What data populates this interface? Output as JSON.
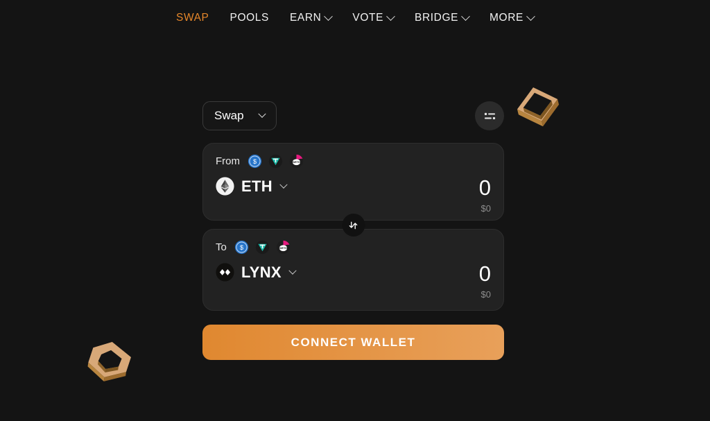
{
  "theme": {
    "page_bg": "#141414",
    "card_bg": "#222222",
    "accent": "#e5862a",
    "button_gradient_from": "#e08830",
    "button_gradient_to": "#e8a05a",
    "text_primary": "#ffffff",
    "text_muted": "#8d8d8d"
  },
  "nav": {
    "items": [
      {
        "label": "SWAP",
        "active": true,
        "has_caret": false
      },
      {
        "label": "POOLS",
        "active": false,
        "has_caret": false
      },
      {
        "label": "EARN",
        "active": false,
        "has_caret": true
      },
      {
        "label": "VOTE",
        "active": false,
        "has_caret": true
      },
      {
        "label": "BRIDGE",
        "active": false,
        "has_caret": true
      },
      {
        "label": "MORE",
        "active": false,
        "has_caret": true
      }
    ]
  },
  "widget": {
    "mode_label": "Swap",
    "settings_icon": "sliders-icon",
    "flip_icon": "swap-vertical-icon",
    "connect_label": "CONNECT WALLET",
    "from": {
      "label": "From",
      "quick_tokens": [
        "USDC",
        "USDT",
        "WETH"
      ],
      "token_symbol": "ETH",
      "token_icon": "eth-icon",
      "amount": "0",
      "amount_placeholder": "0",
      "usd_value": "$0"
    },
    "to": {
      "label": "To",
      "quick_tokens": [
        "USDC",
        "USDT",
        "WETH"
      ],
      "token_symbol": "LYNX",
      "token_icon": "lynx-icon",
      "amount": "0",
      "amount_placeholder": "0",
      "usd_value": "$0"
    }
  },
  "decorations": [
    {
      "name": "floating-diamond-top-right"
    },
    {
      "name": "floating-diamond-bottom-left"
    }
  ]
}
